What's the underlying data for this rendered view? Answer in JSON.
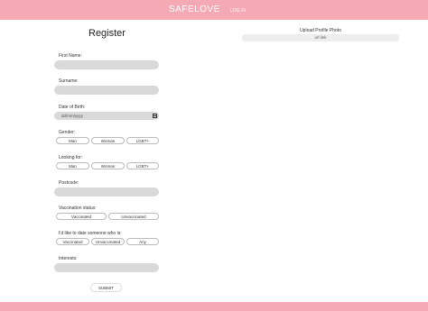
{
  "header": {
    "brand": "SAFELOVE",
    "login": "LOG IN"
  },
  "form": {
    "title": "Register",
    "first_name_label": "First Name:",
    "surname_label": "Surname:",
    "dob_label": "Date of Birth:",
    "dob_placeholder": "dd/mm/yyyy",
    "gender_label": "Gender:",
    "gender_options": [
      "Man",
      "Woman",
      "LGBT+"
    ],
    "looking_label": "Looking for:",
    "looking_options": [
      "Man",
      "Woman",
      "LGBT+"
    ],
    "postcode_label": "Postcode:",
    "vaccination_label": "Vaccination status:",
    "vaccination_options": [
      "Vaccinated",
      "Unvaccinated"
    ],
    "date_pref_label": "I'd like to date someone who is:",
    "date_pref_options": [
      "Vaccinated",
      "Unvaccinated",
      "Any"
    ],
    "interests_label": "Interests:",
    "submit_label": "SUBMIT"
  },
  "upload": {
    "label": "Upload Profile Photo",
    "url_label": "url link"
  }
}
